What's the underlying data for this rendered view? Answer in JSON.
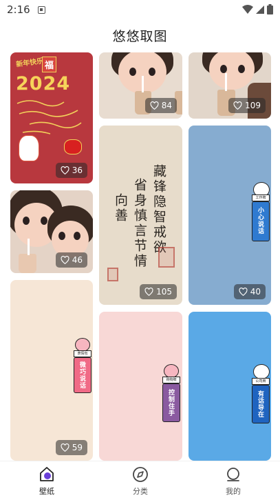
{
  "status_bar": {
    "time": "2:16"
  },
  "header": {
    "title": "悠悠取图"
  },
  "cards": {
    "red_2024": {
      "likes": "36",
      "year": "2024",
      "top_text": "新年快乐",
      "fu": "福"
    },
    "kids_top": {
      "likes": "84"
    },
    "kids_top_right": {
      "likes": "109"
    },
    "calligraphy": {
      "likes": "105",
      "col1": "藏锋隐智戒欲",
      "col2": "省身慎言节情",
      "col3": "向善"
    },
    "blue_sticker": {
      "likes": "40",
      "tag": "工作牌",
      "text": "小心说话"
    },
    "kids_mid": {
      "likes": "46"
    },
    "beige_sticker": {
      "likes": "59",
      "tag": "表情包",
      "text": "微巧说话"
    },
    "pink_sticker": {
      "tag": "购物牌",
      "text": "控制住手"
    },
    "blue2_sticker": {
      "tag": "公司牌",
      "text": "有话导在"
    }
  },
  "bottom_nav": {
    "items": [
      {
        "label": "壁纸",
        "icon": "wallpaper-icon",
        "active": true
      },
      {
        "label": "分类",
        "icon": "compass-icon",
        "active": false
      },
      {
        "label": "我的",
        "icon": "profile-icon",
        "active": false
      }
    ]
  },
  "colors": {
    "accent": "#6a3fd8",
    "blue_card": "#86acd0",
    "blue2_card": "#5aa9e6",
    "pink_card": "#f8d8d6",
    "beige_card": "#f6e6d6",
    "red_card": "#b8383e"
  }
}
